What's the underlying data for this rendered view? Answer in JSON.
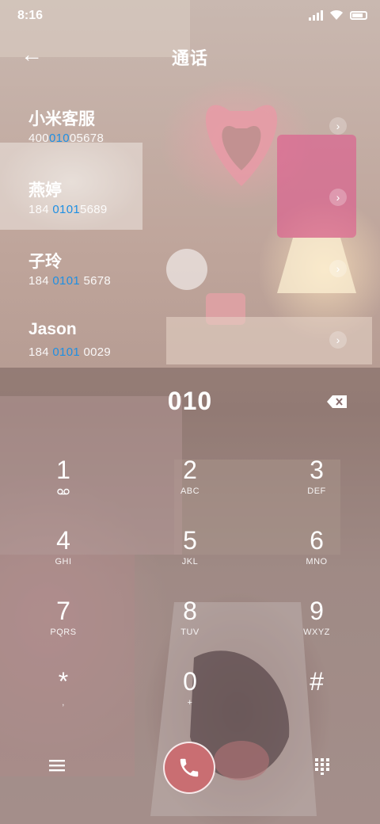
{
  "status_bar": {
    "time": "8:16"
  },
  "header": {
    "back_icon": "back-arrow-icon",
    "title": "通话"
  },
  "contacts": [
    {
      "name": "小米客服",
      "number_pre": "400",
      "number_hl": "010",
      "number_post": "05678"
    },
    {
      "name": "燕婷",
      "number_pre": "184 ",
      "number_hl": "0101",
      "number_post": "5689"
    },
    {
      "name": "子玲",
      "number_pre": "184 ",
      "number_hl": "0101",
      "number_post": " 5678"
    },
    {
      "name": "Jason",
      "number_pre": "184 ",
      "number_hl": "0101",
      "number_post": " 0029"
    }
  ],
  "dialer": {
    "entered": "010",
    "keys": [
      {
        "digit": "1",
        "letters": ""
      },
      {
        "digit": "2",
        "letters": "ABC"
      },
      {
        "digit": "3",
        "letters": "DEF"
      },
      {
        "digit": "4",
        "letters": "GHI"
      },
      {
        "digit": "5",
        "letters": "JKL"
      },
      {
        "digit": "6",
        "letters": "MNO"
      },
      {
        "digit": "7",
        "letters": "PQRS"
      },
      {
        "digit": "8",
        "letters": "TUV"
      },
      {
        "digit": "9",
        "letters": "WXYZ"
      },
      {
        "digit": "*",
        "letters": ","
      },
      {
        "digit": "0",
        "letters": "+"
      },
      {
        "digit": "#",
        "letters": ""
      }
    ]
  },
  "colors": {
    "highlight": "#1e8fe3",
    "call_button": "#c96e72"
  }
}
